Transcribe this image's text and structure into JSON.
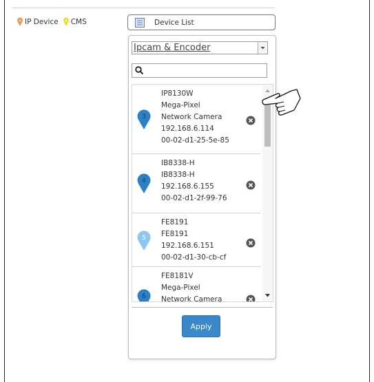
{
  "legend": {
    "ip_device_label": "IP Device",
    "cms_label": "CMS"
  },
  "device_list_button": {
    "label": "Device List",
    "icon": "list-icon"
  },
  "filter": {
    "selected": "Ipcam & Encoder"
  },
  "search": {
    "placeholder": "",
    "icon": "search-icon"
  },
  "devices": [
    {
      "marker_number": "3",
      "lines": [
        "IP8130W",
        "Mega-Pixel",
        "Network Camera",
        "192.168.6.114",
        "00-02-d1-25-5e-85"
      ],
      "marker_color": "#2e7fc4"
    },
    {
      "marker_number": "4",
      "lines": [
        "IB8338-H",
        "IB8338-H",
        "192.168.6.155",
        "00-02-d1-2f-99-76"
      ],
      "marker_color": "#2e7fc4"
    },
    {
      "marker_number": "5",
      "lines": [
        "FE8191",
        "FE8191",
        "192.168.6.151",
        "00-02-d1-30-cb-cf"
      ],
      "marker_color": "#8fc6ef"
    },
    {
      "marker_number": "6",
      "lines": [
        "FE8181V",
        "Mega-Pixel",
        "Network Camera"
      ],
      "marker_color": "#2e7fc4"
    }
  ],
  "apply_label": "Apply",
  "colors": {
    "accent": "#3a87c9",
    "ip_device_pin": "#e8995a",
    "cms_pin": "#e6e035"
  }
}
